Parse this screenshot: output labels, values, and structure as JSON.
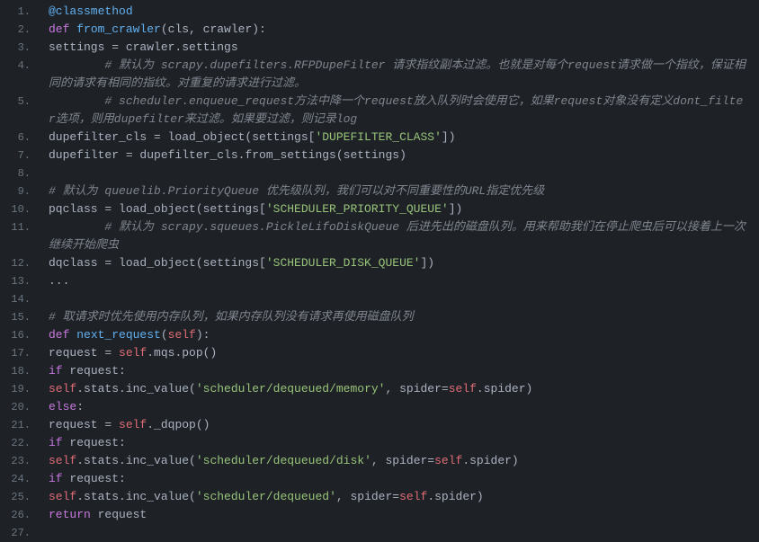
{
  "lines": [
    {
      "num": "1.",
      "indent": 1,
      "segs": [
        {
          "cls": "dec",
          "t": "@classmethod"
        }
      ]
    },
    {
      "num": "2.",
      "indent": 1,
      "segs": [
        {
          "cls": "kw",
          "t": "def "
        },
        {
          "cls": "fn",
          "t": "from_crawler"
        },
        {
          "cls": "op",
          "t": "(cls, crawler):"
        }
      ]
    },
    {
      "num": "3.",
      "indent": 2,
      "segs": [
        {
          "cls": "op",
          "t": "settings = crawler.settings"
        }
      ]
    },
    {
      "num": "4.",
      "indent": 2,
      "wrap": true,
      "segs": [
        {
          "cls": "com",
          "t": "# 默认为 scrapy.dupefilters.RFPDupeFilter 请求指纹副本过滤。也就是对每个request请求做一个指纹，保证相同的请求有相同的指纹。对重复的请求进行过滤。"
        }
      ]
    },
    {
      "num": "5.",
      "indent": 2,
      "wrap": true,
      "segs": [
        {
          "cls": "com",
          "t": "# scheduler.enqueue_request方法中降一个request放入队列时会使用它，如果request对象没有定义dont_filter选项，则用dupefilter来过滤。如果要过滤，则记录log"
        }
      ]
    },
    {
      "num": "6.",
      "indent": 2,
      "segs": [
        {
          "cls": "op",
          "t": "dupefilter_cls = load_object(settings["
        },
        {
          "cls": "str",
          "t": "'DUPEFILTER_CLASS'"
        },
        {
          "cls": "op",
          "t": "])"
        }
      ]
    },
    {
      "num": "7.",
      "indent": 2,
      "segs": [
        {
          "cls": "op",
          "t": "dupefilter = dupefilter_cls.from_settings(settings)"
        }
      ]
    },
    {
      "num": "8.",
      "indent": 0,
      "segs": []
    },
    {
      "num": "9.",
      "indent": 2,
      "segs": [
        {
          "cls": "com",
          "t": "# 默认为 queuelib.PriorityQueue 优先级队列，我们可以对不同重要性的URL指定优先级"
        }
      ]
    },
    {
      "num": "10.",
      "indent": 2,
      "segs": [
        {
          "cls": "op",
          "t": "pqclass = load_object(settings["
        },
        {
          "cls": "str",
          "t": "'SCHEDULER_PRIORITY_QUEUE'"
        },
        {
          "cls": "op",
          "t": "])"
        }
      ]
    },
    {
      "num": "11.",
      "indent": 2,
      "wrap": true,
      "segs": [
        {
          "cls": "com",
          "t": "# 默认为 scrapy.squeues.PickleLifoDiskQueue 后进先出的磁盘队列。用来帮助我们在停止爬虫后可以接着上一次继续开始爬虫"
        }
      ]
    },
    {
      "num": "12.",
      "indent": 2,
      "segs": [
        {
          "cls": "op",
          "t": "dqclass = load_object(settings["
        },
        {
          "cls": "str",
          "t": "'SCHEDULER_DISK_QUEUE'"
        },
        {
          "cls": "op",
          "t": "])"
        }
      ]
    },
    {
      "num": "13.",
      "indent": 2,
      "segs": [
        {
          "cls": "op",
          "t": "..."
        }
      ]
    },
    {
      "num": "14.",
      "indent": 0,
      "segs": []
    },
    {
      "num": "15.",
      "indent": 1,
      "segs": [
        {
          "cls": "com",
          "t": "# 取请求时优先使用内存队列，如果内存队列没有请求再使用磁盘队列"
        }
      ]
    },
    {
      "num": "16.",
      "indent": 1,
      "segs": [
        {
          "cls": "kw",
          "t": "def "
        },
        {
          "cls": "fn",
          "t": "next_request"
        },
        {
          "cls": "op",
          "t": "("
        },
        {
          "cls": "slf",
          "t": "self"
        },
        {
          "cls": "op",
          "t": "):"
        }
      ]
    },
    {
      "num": "17.",
      "indent": 2,
      "segs": [
        {
          "cls": "op",
          "t": "request = "
        },
        {
          "cls": "slf",
          "t": "self"
        },
        {
          "cls": "op",
          "t": ".mqs.pop()"
        }
      ]
    },
    {
      "num": "18.",
      "indent": 2,
      "segs": [
        {
          "cls": "kw",
          "t": "if"
        },
        {
          "cls": "op",
          "t": " request:"
        }
      ]
    },
    {
      "num": "19.",
      "indent": 3,
      "segs": [
        {
          "cls": "slf",
          "t": "self"
        },
        {
          "cls": "op",
          "t": ".stats.inc_value("
        },
        {
          "cls": "str",
          "t": "'scheduler/dequeued/memory'"
        },
        {
          "cls": "op",
          "t": ", spider="
        },
        {
          "cls": "slf",
          "t": "self"
        },
        {
          "cls": "op",
          "t": ".spider)"
        }
      ]
    },
    {
      "num": "20.",
      "indent": 2,
      "segs": [
        {
          "cls": "kw",
          "t": "else"
        },
        {
          "cls": "op",
          "t": ":"
        }
      ]
    },
    {
      "num": "21.",
      "indent": 3,
      "segs": [
        {
          "cls": "op",
          "t": "request = "
        },
        {
          "cls": "slf",
          "t": "self"
        },
        {
          "cls": "op",
          "t": "._dqpop()"
        }
      ]
    },
    {
      "num": "22.",
      "indent": 3,
      "segs": [
        {
          "cls": "kw",
          "t": "if"
        },
        {
          "cls": "op",
          "t": " request:"
        }
      ]
    },
    {
      "num": "23.",
      "indent": 4,
      "segs": [
        {
          "cls": "slf",
          "t": "self"
        },
        {
          "cls": "op",
          "t": ".stats.inc_value("
        },
        {
          "cls": "str",
          "t": "'scheduler/dequeued/disk'"
        },
        {
          "cls": "op",
          "t": ", spider="
        },
        {
          "cls": "slf",
          "t": "self"
        },
        {
          "cls": "op",
          "t": ".spider)"
        }
      ]
    },
    {
      "num": "24.",
      "indent": 2,
      "segs": [
        {
          "cls": "kw",
          "t": "if"
        },
        {
          "cls": "op",
          "t": " request:"
        }
      ]
    },
    {
      "num": "25.",
      "indent": 3,
      "segs": [
        {
          "cls": "slf",
          "t": "self"
        },
        {
          "cls": "op",
          "t": ".stats.inc_value("
        },
        {
          "cls": "str",
          "t": "'scheduler/dequeued'"
        },
        {
          "cls": "op",
          "t": ", spider="
        },
        {
          "cls": "slf",
          "t": "self"
        },
        {
          "cls": "op",
          "t": ".spider)"
        }
      ]
    },
    {
      "num": "26.",
      "indent": 2,
      "segs": [
        {
          "cls": "kw",
          "t": "return"
        },
        {
          "cls": "op",
          "t": " request"
        }
      ]
    },
    {
      "num": "27.",
      "indent": 0,
      "segs": []
    }
  ],
  "indentUnit": "    "
}
